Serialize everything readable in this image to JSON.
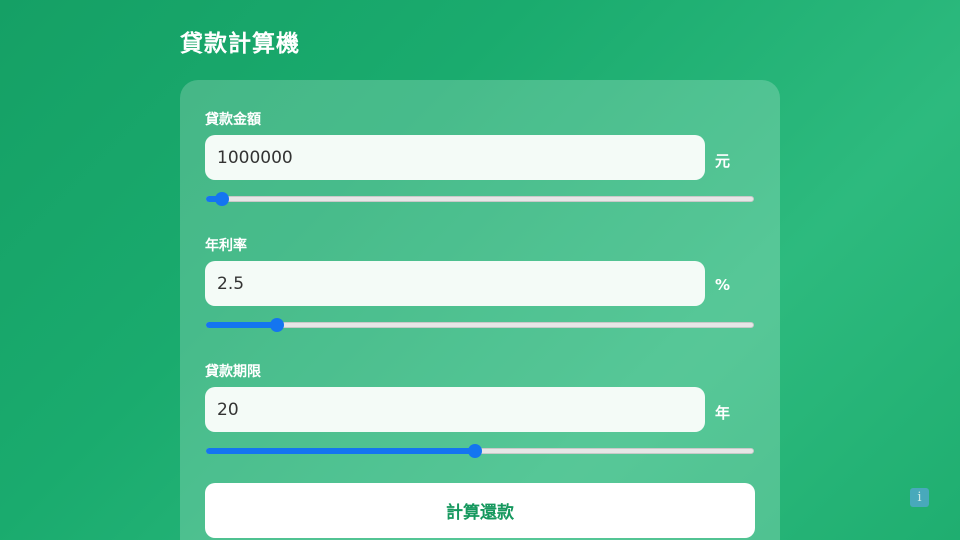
{
  "page": {
    "title": "貸款計算機"
  },
  "fields": [
    {
      "label": "貸款金額",
      "value": "1000000",
      "unit": "元",
      "slider_fraction": 0.03
    },
    {
      "label": "年利率",
      "value": "2.5",
      "unit": "%",
      "slider_fraction": 0.13
    },
    {
      "label": "貸款期限",
      "value": "20",
      "unit": "年",
      "slider_fraction": 0.49
    }
  ],
  "button": {
    "label": "計算還款"
  },
  "icons": {
    "info": "info-icon"
  },
  "colors": {
    "background": "#1aab6e",
    "accent": "#1475f0",
    "button_text": "#16985e"
  }
}
